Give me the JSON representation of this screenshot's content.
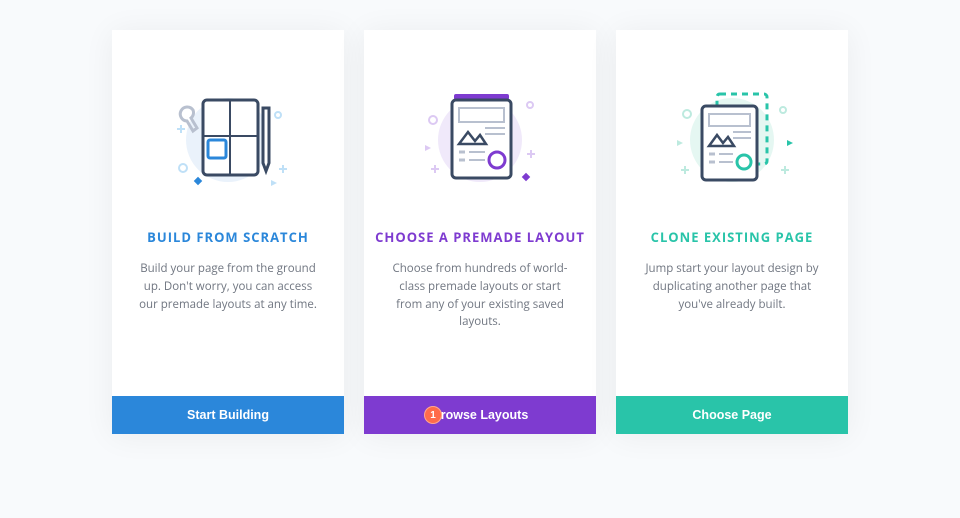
{
  "cards": [
    {
      "title": "BUILD FROM SCRATCH",
      "desc": "Build your page from the ground up. Don't worry, you can access our premade layouts at any time.",
      "button": "Start Building"
    },
    {
      "title": "CHOOSE A PREMADE LAYOUT",
      "desc": "Choose from hundreds of world-class premade layouts or start from any of your existing saved layouts.",
      "button": "Browse Layouts",
      "badge": "1"
    },
    {
      "title": "CLONE EXISTING PAGE",
      "desc": "Jump start your layout design by duplicating another page that you've already built.",
      "button": "Choose Page"
    }
  ]
}
